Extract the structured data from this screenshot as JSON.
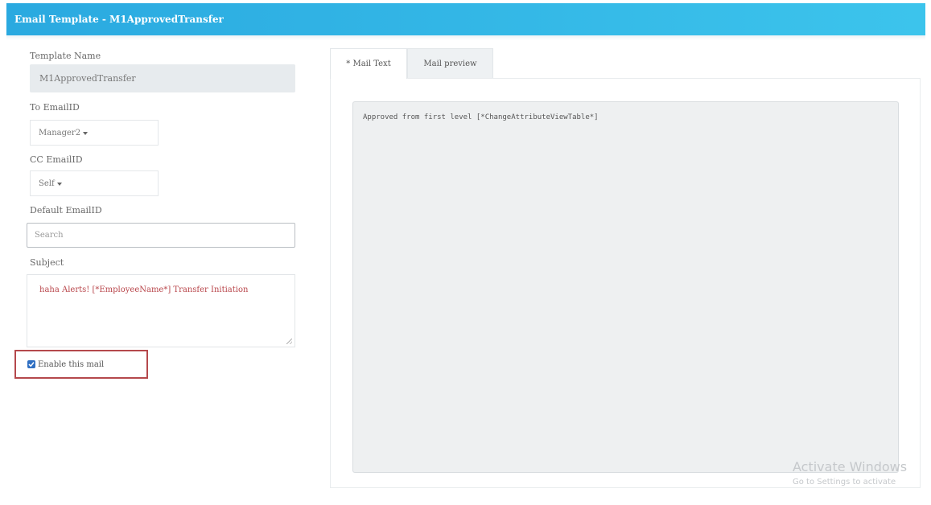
{
  "header": {
    "title": "Email Template - M1ApprovedTransfer"
  },
  "form": {
    "template_name_label": "Template Name",
    "template_name_value": "M1ApprovedTransfer",
    "to_email_label": "To EmailID",
    "to_email_value": "Manager2",
    "cc_email_label": "CC EmailID",
    "cc_email_value": "Self",
    "default_email_label": "Default EmailID",
    "default_email_placeholder": "Search",
    "subject_label": "Subject",
    "subject_value": "haha Alerts! [*EmployeeName*] Transfer Initiation",
    "enable_label": "Enable this mail",
    "enable_checked": true
  },
  "tabs": [
    {
      "label": "* Mail Text",
      "active": true
    },
    {
      "label": "Mail preview",
      "active": false
    }
  ],
  "mail_text": {
    "content": "Approved from first level [*ChangeAttributeViewTable*]"
  },
  "watermark": {
    "title": "Activate Windows",
    "subtitle": "Go to Settings to activate"
  },
  "colors": {
    "header_bg": "#2aa9e0",
    "highlight_border": "#b5484c",
    "subject_text": "#b8454a",
    "checkbox": "#2f6fc2"
  }
}
